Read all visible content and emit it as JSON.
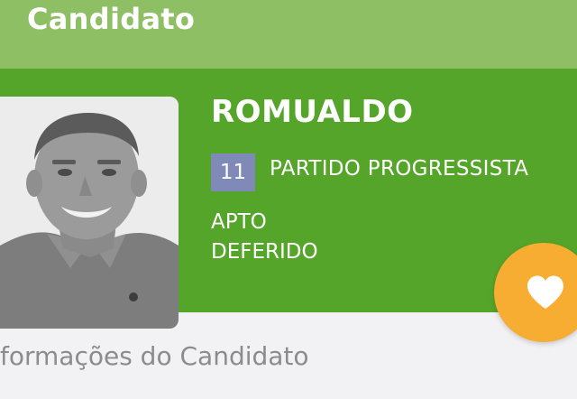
{
  "header": {
    "title": "Candidato"
  },
  "candidate": {
    "name": "ROMUALDO",
    "party_number": "11",
    "party_name": "PARTIDO PROGRESSISTA",
    "status_line_1": "APTO",
    "status_line_2": "DEFERIDO",
    "photo_icon": "candidate-portrait"
  },
  "favorite": {
    "icon": "heart-icon"
  },
  "section": {
    "title": "formações do Candidato"
  },
  "colors": {
    "header_bg": "#8fbf64",
    "card_bg": "#56a52b",
    "party_badge_bg": "#7f8ab9",
    "favorite_bg": "#f6ad32",
    "page_bg": "#f2f2f4",
    "section_text": "#8b8b90"
  }
}
